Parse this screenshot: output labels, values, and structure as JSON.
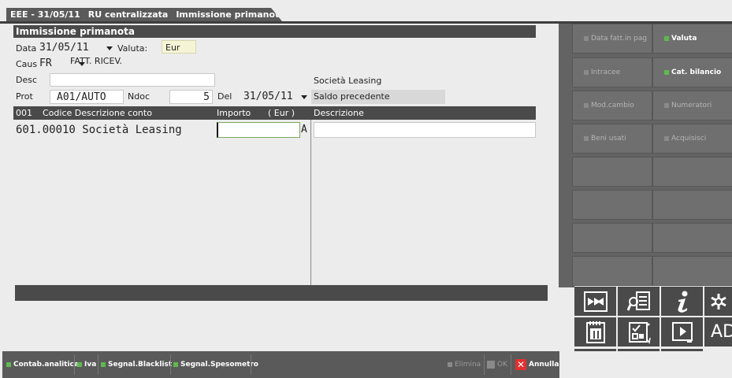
{
  "tabs": [
    "EEE - 31/05/11",
    "RU centralizzata",
    "Immissione primanota"
  ],
  "form": {
    "title": "Immissione primanota",
    "data_label": "Data",
    "data_value": "31/05/11",
    "valuta_label": "Valuta:",
    "valuta_value": "Eur",
    "caus_label": "Caus",
    "caus_value": "FR",
    "caus_desc": "FATT. RICEV.",
    "desc_label": "Desc",
    "desc_value": "",
    "prot_label": "Prot",
    "prot_value": "A01/AUTO",
    "ndoc_label": "Ndoc",
    "ndoc_value": "5",
    "del_label": "Del",
    "del_value": "31/05/11",
    "side_name": "Società Leasing",
    "side_saldo": "Saldo precedente"
  },
  "grid": {
    "headers": {
      "num": "001",
      "codice": "Codice Descrizione conto",
      "importo": "Importo",
      "currency": "( Eur )",
      "descrizione": "Descrizione"
    },
    "row": {
      "conto": "601.00010 Società Leasing",
      "importo": "",
      "segno": "A",
      "descrizione": ""
    }
  },
  "right_panel": {
    "buttons": [
      {
        "label": "Data fatt.in pag",
        "active": false
      },
      {
        "label": "Valuta",
        "active": true
      },
      {
        "label": "Intracee",
        "active": false
      },
      {
        "label": "Cat. bilancio",
        "active": true
      },
      {
        "label": "Mod.cambio",
        "active": false
      },
      {
        "label": "Numeratori",
        "active": false
      },
      {
        "label": "Beni usati",
        "active": false
      },
      {
        "label": "Acquisisci",
        "active": false
      }
    ]
  },
  "icons": [
    "double-arrow-icon",
    "search-document-icon",
    "info-icon",
    "asterisk-icon",
    "calendar-icon",
    "calculator-icon",
    "play-icon",
    "ad-icon",
    "keyboard-icon",
    "grid-icon",
    "message-icon"
  ],
  "icon_text": {
    "ad": "AD"
  },
  "bottom_bar": {
    "contab": "Contab.analitica",
    "iva": "Iva",
    "blacklist": "Segnal.Blacklist",
    "spesometro": "Segnal.Spesometro",
    "elimina": "Elimina",
    "ok": "OK",
    "annulla": "Annulla"
  },
  "colors": {
    "accent_green": "#5fb850",
    "cancel_red": "#e03030",
    "header_gray": "#4a4a4a"
  }
}
